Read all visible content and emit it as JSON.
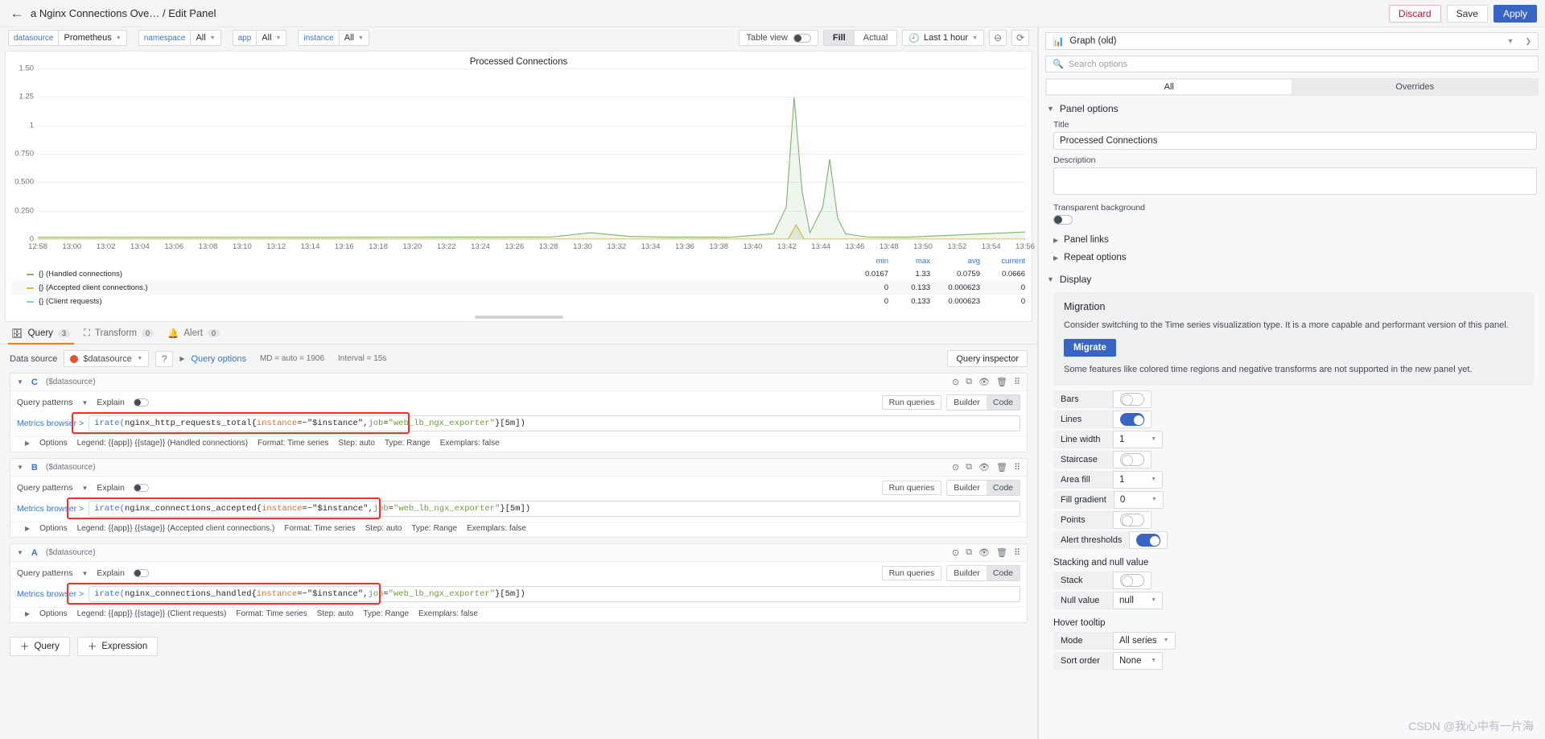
{
  "header": {
    "back_icon": "arrow-left-icon",
    "breadcrumb": "a Nginx Connections Ove… / Edit Panel",
    "discard_label": "Discard",
    "save_label": "Save",
    "apply_label": "Apply"
  },
  "variables": [
    {
      "label": "datasource",
      "value": "Prometheus"
    },
    {
      "label": "namespace",
      "value": "All"
    },
    {
      "label": "app",
      "value": "All"
    },
    {
      "label": "instance",
      "value": "All"
    }
  ],
  "viz_toolbar": {
    "table_view_label": "Table view",
    "table_view_on": false,
    "fill_label": "Fill",
    "actual_label": "Actual",
    "fill_selected": true,
    "time_range": "Last 1 hour",
    "clock_icon": "clock-icon",
    "zoom_out_icon": "zoom-out-icon",
    "refresh_icon": "refresh-icon"
  },
  "chart_data": {
    "type": "line",
    "title": "Processed Connections",
    "xlabel": "",
    "ylabel": "",
    "ylim": [
      0,
      1.6
    ],
    "yticks": [
      "1.50",
      "1.25",
      "1",
      "0.750",
      "0.500",
      "0.250",
      "0"
    ],
    "ytick_values": [
      1.5,
      1.25,
      1.0,
      0.75,
      0.5,
      0.25,
      0
    ],
    "xticks": [
      "12:58",
      "13:00",
      "13:02",
      "13:04",
      "13:06",
      "13:08",
      "13:10",
      "13:12",
      "13:14",
      "13:16",
      "13:18",
      "13:20",
      "13:22",
      "13:24",
      "13:26",
      "13:28",
      "13:30",
      "13:32",
      "13:34",
      "13:36",
      "13:38",
      "13:40",
      "13:42",
      "13:44",
      "13:46",
      "13:48",
      "13:50",
      "13:52",
      "13:54",
      "13:56"
    ],
    "grid": true,
    "legend_position": "bottom",
    "series": [
      {
        "name": "{} (Handled connections)",
        "color": "#7eb26d",
        "min": "0.0167",
        "max": "1.33",
        "avg": "0.0759",
        "current": "0.0666",
        "points": [
          [
            0,
            0.017
          ],
          [
            0.3,
            0.017
          ],
          [
            0.52,
            0.02
          ],
          [
            0.56,
            0.06
          ],
          [
            0.6,
            0.025
          ],
          [
            0.64,
            0.018
          ],
          [
            0.7,
            0.017
          ],
          [
            0.745,
            0.05
          ],
          [
            0.758,
            0.3
          ],
          [
            0.766,
            1.33
          ],
          [
            0.774,
            0.45
          ],
          [
            0.782,
            0.06
          ],
          [
            0.795,
            0.3
          ],
          [
            0.802,
            0.75
          ],
          [
            0.81,
            0.2
          ],
          [
            0.818,
            0.05
          ],
          [
            0.84,
            0.02
          ],
          [
            0.88,
            0.018
          ],
          [
            1.0,
            0.0666
          ]
        ]
      },
      {
        "name": "{} (Accepted client connections.)",
        "color": "#eab839",
        "min": "0",
        "max": "0.133",
        "avg": "0.000623",
        "current": "0",
        "points": [
          [
            0,
            0
          ],
          [
            0.76,
            0
          ],
          [
            0.768,
            0.133
          ],
          [
            0.776,
            0
          ],
          [
            1.0,
            0
          ]
        ]
      },
      {
        "name": "{} (Client requests)",
        "color": "#6ed0e0",
        "min": "0",
        "max": "0.133",
        "avg": "0.000623",
        "current": "0",
        "points": [
          [
            0,
            0
          ],
          [
            0.76,
            0
          ],
          [
            0.768,
            0.133
          ],
          [
            0.776,
            0
          ],
          [
            1.0,
            0
          ]
        ]
      }
    ],
    "legend_columns": [
      "min",
      "max",
      "avg",
      "current"
    ]
  },
  "tabs": [
    {
      "label": "Query",
      "count": "3",
      "icon": "database-icon",
      "active": true
    },
    {
      "label": "Transform",
      "count": "0",
      "icon": "transform-icon",
      "active": false
    },
    {
      "label": "Alert",
      "count": "0",
      "icon": "bell-icon",
      "active": false
    }
  ],
  "query_bar": {
    "datasource_label": "Data source",
    "datasource_value": "$datasource",
    "help_icon": "help-circle-icon",
    "query_options_label": "Query options",
    "query_options_meta_md": "MD = auto = 1906",
    "query_options_meta_interval": "Interval = 15s",
    "query_inspector_label": "Query inspector"
  },
  "queries": [
    {
      "ref": "C",
      "datasource": "($datasource)",
      "query_patterns_label": "Query patterns",
      "explain_label": "Explain",
      "explain_on": false,
      "run_label": "Run queries",
      "builder_label": "Builder",
      "code_label": "Code",
      "mode_selected": "Code",
      "metrics_browser_label": "Metrics browser >",
      "expr_fn": "irate(",
      "expr_metric": "nginx_http_requests_total{",
      "expr_label1": "instance",
      "expr_op1": "=~",
      "expr_val1": "\"$instance\", ",
      "expr_label2": "job",
      "expr_op2": "=",
      "expr_val2": "\"web_lb_ngx_exporter\"",
      "expr_tail": "}[5m])",
      "expr_full": "irate(nginx_http_requests_total{instance=~\"$instance\", job=\"web_lb_ngx_exporter\"}[5m])",
      "options_label": "Options",
      "opt_legend": "Legend: {{app}} {{stage}} (Handled connections)",
      "opt_format": "Format: Time series",
      "opt_step": "Step: auto",
      "opt_type": "Type: Range",
      "opt_exemplars": "Exemplars: false",
      "highlight": true
    },
    {
      "ref": "B",
      "datasource": "($datasource)",
      "query_patterns_label": "Query patterns",
      "explain_label": "Explain",
      "explain_on": false,
      "run_label": "Run queries",
      "builder_label": "Builder",
      "code_label": "Code",
      "mode_selected": "Code",
      "metrics_browser_label": "Metrics browser >",
      "expr_fn": "irate(",
      "expr_metric": "nginx_connections_accepted{",
      "expr_label1": "instance",
      "expr_op1": "=~",
      "expr_val1": "\"$instance\", ",
      "expr_label2": "job",
      "expr_op2": "=",
      "expr_val2": "\"web_lb_ngx_exporter\"",
      "expr_tail": "}[5m])",
      "expr_full": "irate(nginx_connections_accepted{instance=~\"$instance\", job=\"web_lb_ngx_exporter\"}[5m])",
      "options_label": "Options",
      "opt_legend": "Legend: {{app}} {{stage}} (Accepted client connections.)",
      "opt_format": "Format: Time series",
      "opt_step": "Step: auto",
      "opt_type": "Type: Range",
      "opt_exemplars": "Exemplars: false",
      "highlight": true
    },
    {
      "ref": "A",
      "datasource": "($datasource)",
      "query_patterns_label": "Query patterns",
      "explain_label": "Explain",
      "explain_on": false,
      "run_label": "Run queries",
      "builder_label": "Builder",
      "code_label": "Code",
      "mode_selected": "Code",
      "metrics_browser_label": "Metrics browser >",
      "expr_fn": "irate(",
      "expr_metric": "nginx_connections_handled{",
      "expr_label1": "instance",
      "expr_op1": "=~",
      "expr_val1": "\"$instance\", ",
      "expr_label2": "job",
      "expr_op2": "=",
      "expr_val2": "\"web_lb_ngx_exporter\"",
      "expr_tail": "}[5m])",
      "expr_full": "irate(nginx_connections_handled{instance=~\"$instance\", job=\"web_lb_ngx_exporter\"}[5m])",
      "options_label": "Options",
      "opt_legend": "Legend: {{app}} {{stage}} (Client requests)",
      "opt_format": "Format: Time series",
      "opt_step": "Step: auto",
      "opt_type": "Type: Range",
      "opt_exemplars": "Exemplars: false",
      "highlight": true
    }
  ],
  "bottom_actions": {
    "add_query_label": "Query",
    "add_expression_label": "Expression",
    "plus_icon": "plus-icon"
  },
  "options_pane": {
    "viz_name": "Graph (old)",
    "viz_icon": "bar-chart-icon",
    "search_placeholder": "Search options",
    "search_icon": "search-icon",
    "tab_all": "All",
    "tab_overrides": "Overrides",
    "panel_options_title": "Panel options",
    "title_label": "Title",
    "title_value": "Processed Connections",
    "description_label": "Description",
    "description_value": "",
    "transparent_label": "Transparent background",
    "transparent_on": false,
    "panel_links_label": "Panel links",
    "repeat_options_label": "Repeat options",
    "display_title": "Display",
    "migration": {
      "heading": "Migration",
      "body": "Consider switching to the Time series visualization type. It is a more capable and performant version of this panel.",
      "button": "Migrate",
      "footnote": "Some features like colored time regions and negative transforms are not supported in the new panel yet."
    },
    "display_options": [
      {
        "label": "Bars",
        "type": "toggle",
        "value": false
      },
      {
        "label": "Lines",
        "type": "toggle",
        "value": true
      },
      {
        "label": "Line width",
        "type": "select",
        "value": "1"
      },
      {
        "label": "Staircase",
        "type": "toggle",
        "value": false
      },
      {
        "label": "Area fill",
        "type": "select",
        "value": "1"
      },
      {
        "label": "Fill gradient",
        "type": "select",
        "value": "0"
      },
      {
        "label": "Points",
        "type": "toggle",
        "value": false
      },
      {
        "label": "Alert thresholds",
        "type": "toggle",
        "value": true
      }
    ],
    "stacking_title": "Stacking and null value",
    "stacking_options": [
      {
        "label": "Stack",
        "type": "toggle",
        "value": false
      },
      {
        "label": "Null value",
        "type": "select",
        "value": "null"
      }
    ],
    "tooltip_title": "Hover tooltip",
    "tooltip_options": [
      {
        "label": "Mode",
        "type": "select",
        "value": "All series"
      },
      {
        "label": "Sort order",
        "type": "select",
        "value": "None"
      }
    ]
  },
  "watermark": "CSDN @我心中有一片海"
}
